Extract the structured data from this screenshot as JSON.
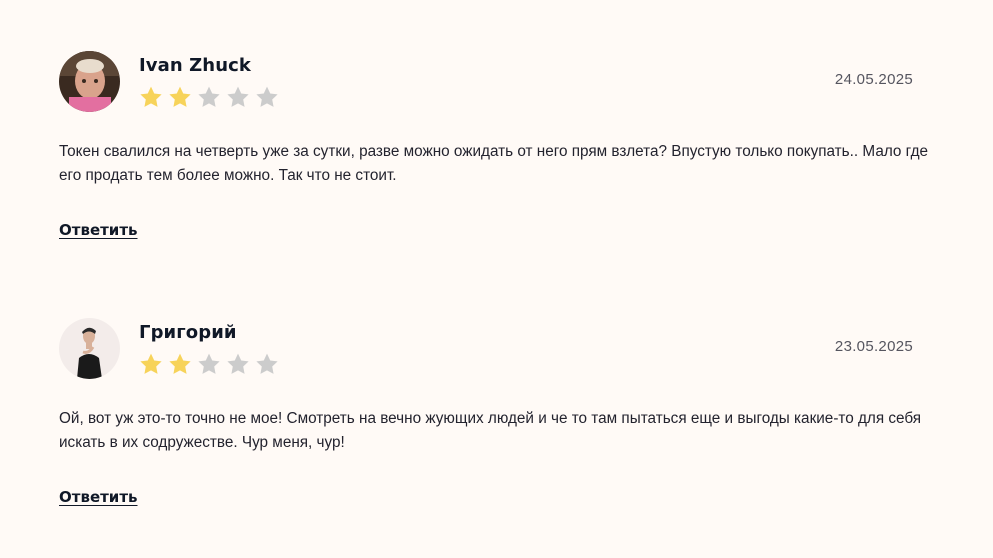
{
  "reviews": [
    {
      "author": "Ivan Zhuck",
      "date": "24.05.2025",
      "rating": 2,
      "max_rating": 5,
      "text": "Токен свалился на четверть уже за сутки, разве можно ожидать от него прям взлета? Впустую только покупать.. Мало где его продать тем более можно. Так что не стоит.",
      "reply_label": "Ответить"
    },
    {
      "author": "Григорий",
      "date": "23.05.2025",
      "rating": 2,
      "max_rating": 5,
      "text": "Ой, вот уж это-то точно не мое! Смотреть на вечно жующих людей и че то там пытаться еще и выгоды какие-то для себя искать в их содружестве. Чур меня, чур!",
      "reply_label": "Ответить"
    }
  ],
  "colors": {
    "star_filled": "#f7d35a",
    "star_empty": "#cccccc",
    "background": "#fffaf6"
  },
  "icons": {
    "star": "star-icon"
  }
}
